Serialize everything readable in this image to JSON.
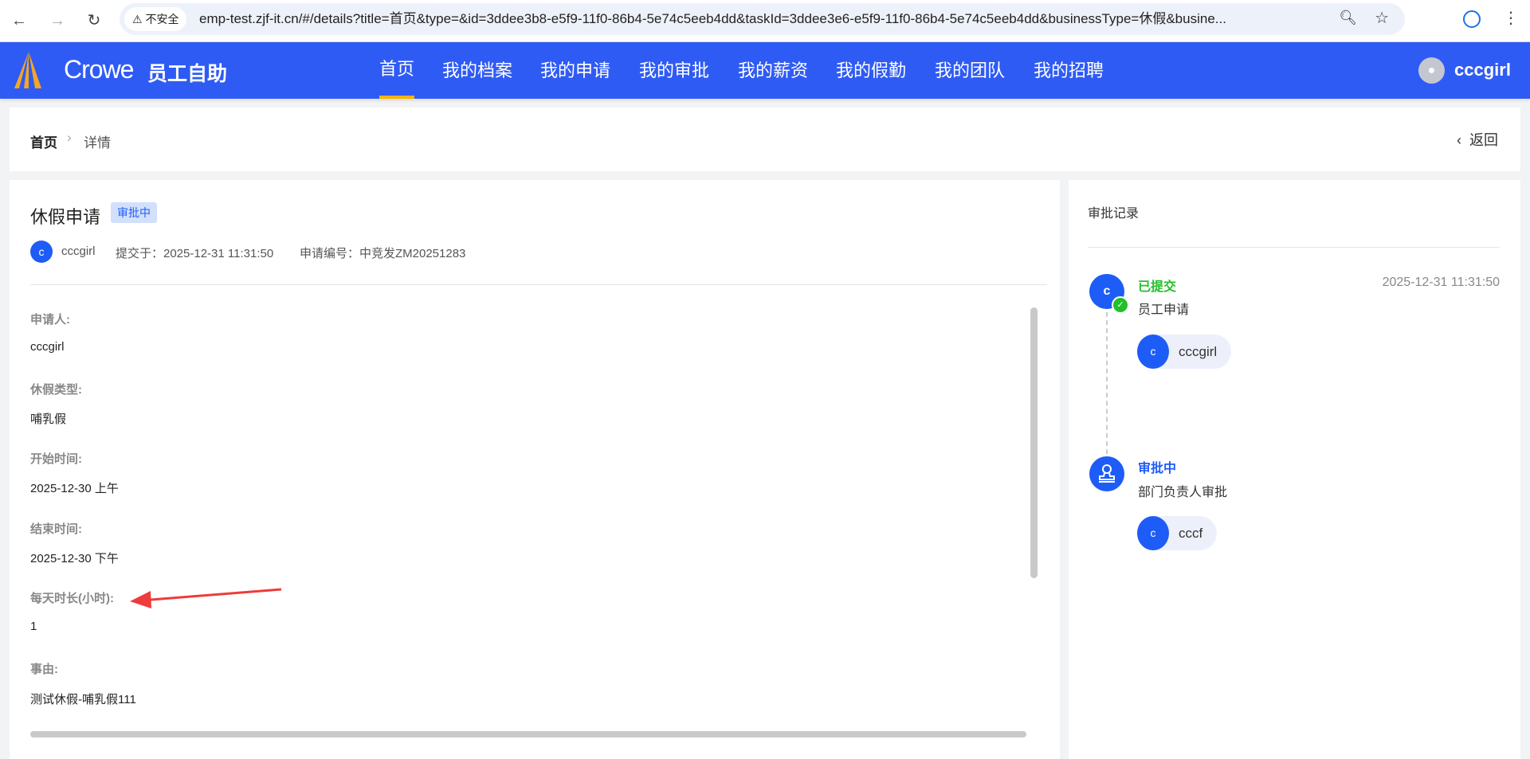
{
  "browser": {
    "security": "不安全",
    "url": "emp-test.zjf-it.cn/#/details?title=首页&type=&id=3ddee3b8-e5f9-11f0-86b4-5e74c5eeb4dd&taskId=3ddee3e6-e5f9-11f0-86b4-5e74c5eeb4dd&businessType=休假&busine..."
  },
  "header": {
    "logo_text": "Crowe",
    "app_name": "员工自助",
    "nav": [
      "首页",
      "我的档案",
      "我的申请",
      "我的审批",
      "我的薪资",
      "我的假勤",
      "我的团队",
      "我的招聘"
    ],
    "username": "cccgirl"
  },
  "breadcrumb": {
    "home": "首页",
    "current": "详情",
    "back": "返回"
  },
  "detail": {
    "title": "休假申请",
    "status": "审批中",
    "avatar_letter": "c",
    "applicant": "cccgirl",
    "submitted": "提交于：2025-12-31 11:31:50",
    "number": "申请编号：中竞发ZM20251283",
    "fields": [
      {
        "label": "申请人:",
        "value": "cccgirl"
      },
      {
        "label": "休假类型:",
        "value": "哺乳假"
      },
      {
        "label": "开始时间:",
        "value": "2025-12-30 上午"
      },
      {
        "label": "结束时间:",
        "value": "2025-12-30 下午"
      },
      {
        "label": "每天时长(小时):",
        "value": "1"
      },
      {
        "label": "事由:",
        "value": "测试休假-哺乳假111"
      }
    ]
  },
  "approval": {
    "title": "审批记录",
    "steps": [
      {
        "status": "已提交",
        "status_color": "#22c02a",
        "time": "2025-12-31 11:31:50",
        "node": "员工申请",
        "avatar_letter": "c",
        "user": "cccgirl",
        "user_letter": "c"
      },
      {
        "status": "审批中",
        "status_color": "#1e5cf8",
        "node": "部门负责人审批",
        "user": "cccf",
        "user_letter": "c"
      }
    ]
  }
}
